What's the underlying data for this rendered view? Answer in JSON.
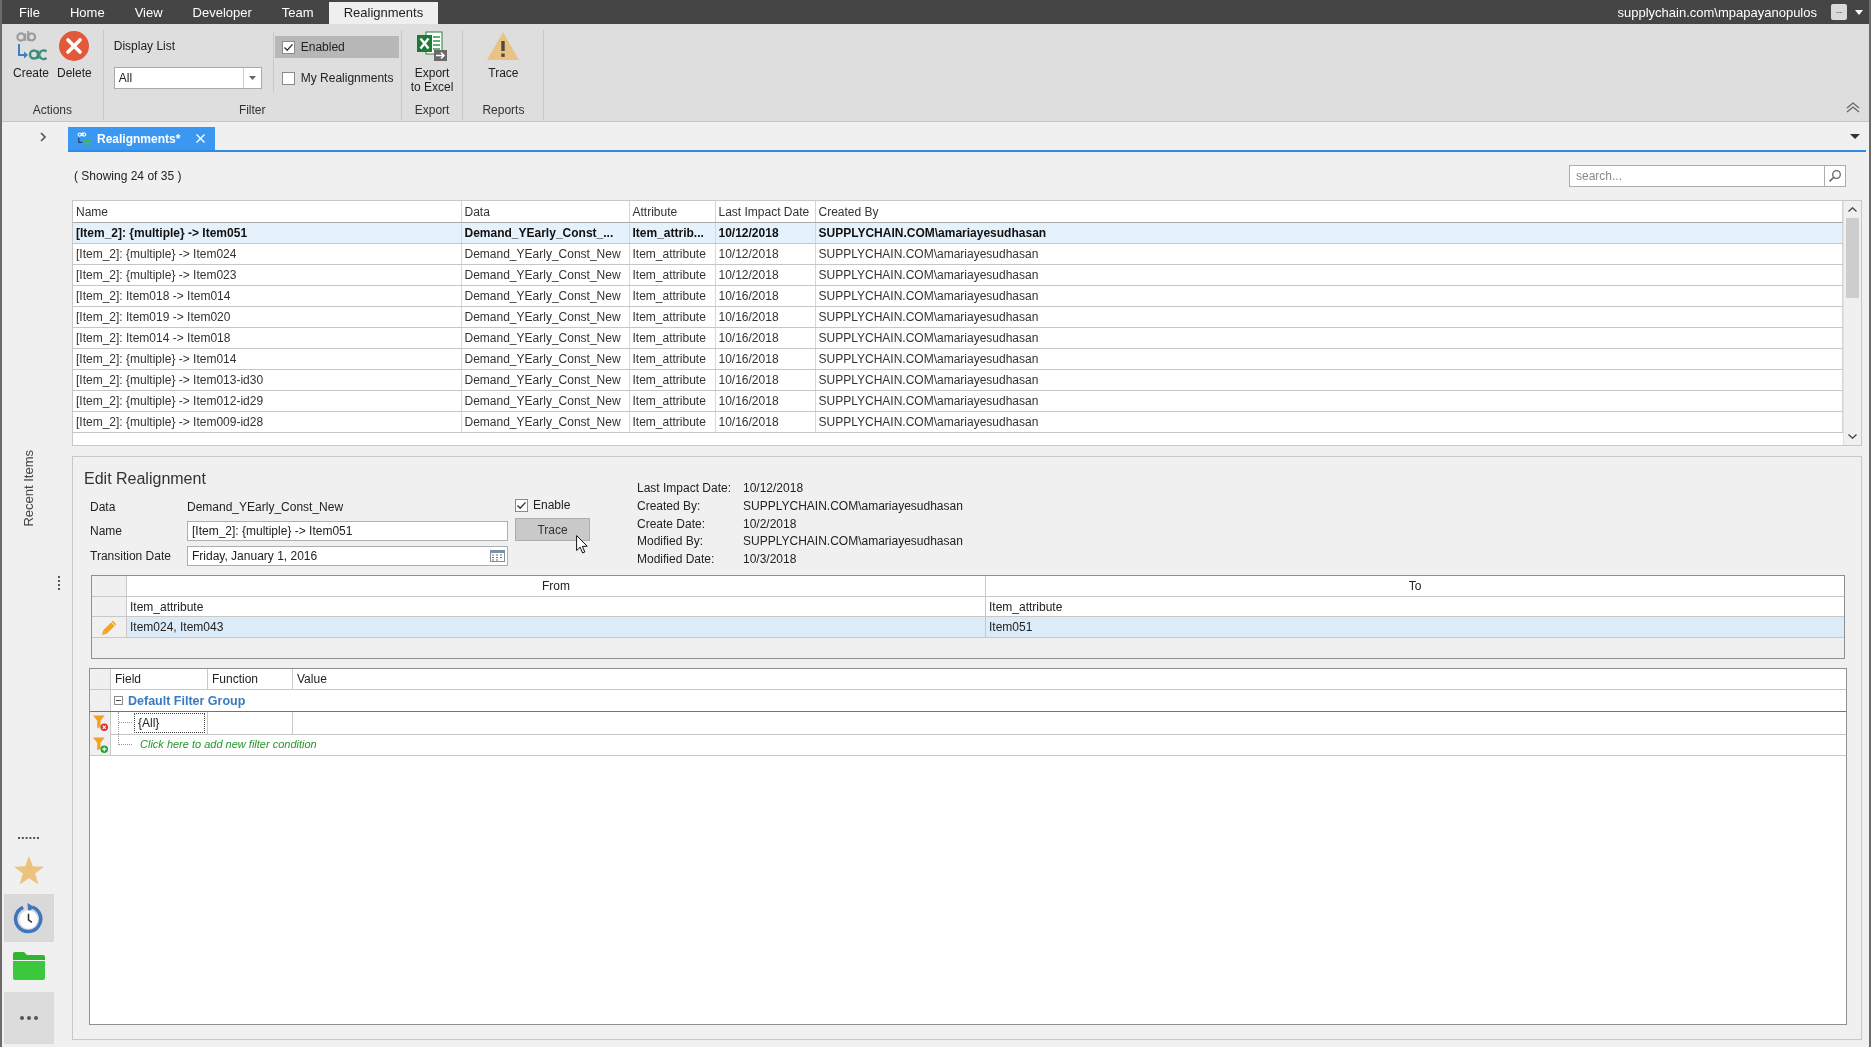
{
  "menu_bar": {
    "tabs": [
      {
        "label": "File",
        "selected": false
      },
      {
        "label": "Home",
        "selected": false
      },
      {
        "label": "View",
        "selected": false
      },
      {
        "label": "Developer",
        "selected": false
      },
      {
        "label": "Team",
        "selected": false
      },
      {
        "label": "Realignments",
        "selected": true
      }
    ],
    "user": "supplychain.com\\mpapayanopulos",
    "user_menu_button": "--"
  },
  "ribbon": {
    "groups": [
      {
        "label": "Actions",
        "kind": "buttons",
        "buttons": [
          {
            "label": "Create",
            "kind": "create"
          },
          {
            "label": "Delete",
            "kind": "delete"
          }
        ]
      },
      {
        "label": "Filter",
        "kind": "filter",
        "display_list": {
          "label": "Display List",
          "value": "All"
        },
        "checkboxes": [
          {
            "label": "Enabled",
            "checked": true,
            "highlighted": true
          },
          {
            "label": "My Realignments",
            "checked": false,
            "highlighted": false
          }
        ]
      },
      {
        "label": "Export",
        "kind": "buttons",
        "buttons": [
          {
            "label": "Export\nto Excel",
            "kind": "excel"
          }
        ]
      },
      {
        "label": "Reports",
        "kind": "buttons",
        "buttons": [
          {
            "label": "Trace",
            "kind": "trace"
          }
        ]
      }
    ]
  },
  "doc_tabs": [
    {
      "label": "Realignments*",
      "selected": true
    }
  ],
  "sidebar": {
    "title": "Recent Items",
    "items": [
      {
        "kind": "favorites",
        "selected": false
      },
      {
        "kind": "recent",
        "selected": true
      },
      {
        "kind": "folders",
        "selected": false
      }
    ]
  },
  "list": {
    "summary": "( Showing 24 of 35 )",
    "search": {
      "placeholder": "search..."
    },
    "table": {
      "columns": [
        "Name",
        "Data",
        "Attribute",
        "Last Impact Date",
        "Created By"
      ],
      "rows": [
        {
          "cells": [
            "[Item_2]: {multiple} -> Item051",
            "Demand_YEarly_Const_...",
            "Item_attrib...",
            "10/12/2018",
            "SUPPLYCHAIN.COM\\amariayesudhasan"
          ],
          "selected": true
        },
        {
          "cells": [
            "[Item_2]: {multiple} -> Item024",
            "Demand_YEarly_Const_New",
            "Item_attribute",
            "10/12/2018",
            "SUPPLYCHAIN.COM\\amariayesudhasan"
          ],
          "selected": false
        },
        {
          "cells": [
            "[Item_2]: {multiple} -> Item023",
            "Demand_YEarly_Const_New",
            "Item_attribute",
            "10/12/2018",
            "SUPPLYCHAIN.COM\\amariayesudhasan"
          ],
          "selected": false
        },
        {
          "cells": [
            "[Item_2]: Item018 -> Item014",
            "Demand_YEarly_Const_New",
            "Item_attribute",
            "10/16/2018",
            "SUPPLYCHAIN.COM\\amariayesudhasan"
          ],
          "selected": false
        },
        {
          "cells": [
            "[Item_2]: Item019 -> Item020",
            "Demand_YEarly_Const_New",
            "Item_attribute",
            "10/16/2018",
            "SUPPLYCHAIN.COM\\amariayesudhasan"
          ],
          "selected": false
        },
        {
          "cells": [
            "[Item_2]: Item014 -> Item018",
            "Demand_YEarly_Const_New",
            "Item_attribute",
            "10/16/2018",
            "SUPPLYCHAIN.COM\\amariayesudhasan"
          ],
          "selected": false
        },
        {
          "cells": [
            "[Item_2]: {multiple} -> Item014",
            "Demand_YEarly_Const_New",
            "Item_attribute",
            "10/16/2018",
            "SUPPLYCHAIN.COM\\amariayesudhasan"
          ],
          "selected": false
        },
        {
          "cells": [
            "[Item_2]: {multiple} -> Item013-id30",
            "Demand_YEarly_Const_New",
            "Item_attribute",
            "10/16/2018",
            "SUPPLYCHAIN.COM\\amariayesudhasan"
          ],
          "selected": false
        },
        {
          "cells": [
            "[Item_2]: {multiple} -> Item012-id29",
            "Demand_YEarly_Const_New",
            "Item_attribute",
            "10/16/2018",
            "SUPPLYCHAIN.COM\\amariayesudhasan"
          ],
          "selected": false
        },
        {
          "cells": [
            "[Item_2]: {multiple} -> Item009-id28",
            "Demand_YEarly_Const_New",
            "Item_attribute",
            "10/16/2018",
            "SUPPLYCHAIN.COM\\amariayesudhasan"
          ],
          "selected": false
        }
      ]
    }
  },
  "edit_panel": {
    "title": "Edit Realignment",
    "data": {
      "label": "Data",
      "value": "Demand_YEarly_Const_New"
    },
    "name": {
      "label": "Name",
      "value": "[Item_2]: {multiple} -> Item051"
    },
    "transition_date": {
      "label": "Transition Date",
      "value": "Friday, January 1, 2016"
    },
    "enable": {
      "label": "Enable",
      "checked": true
    },
    "trace_button": "Trace",
    "info": [
      {
        "label": "Last Impact Date:",
        "value": "10/12/2018"
      },
      {
        "label": "Created By:",
        "value": "SUPPLYCHAIN.COM\\amariayesudhasan"
      },
      {
        "label": "Create Date:",
        "value": "10/2/2018"
      },
      {
        "label": "Modified By:",
        "value": "SUPPLYCHAIN.COM\\amariayesudhasan"
      },
      {
        "label": "Modified Date:",
        "value": "10/3/2018"
      }
    ],
    "mapping_grid": {
      "columns": [
        "From",
        "To"
      ],
      "attributes": [
        "Item_attribute",
        "Item_attribute"
      ],
      "rows": [
        {
          "from": "Item024, Item043",
          "to": "Item051",
          "selected": true,
          "editing": true
        }
      ]
    },
    "filter_grid": {
      "columns": [
        "Field",
        "Function",
        "Value"
      ],
      "group": {
        "label": "Default Filter Group",
        "expanded": true
      },
      "conditions": [
        {
          "field": "{All}",
          "focused": true
        }
      ],
      "add_hint": "Click here to add new filter condition"
    }
  }
}
